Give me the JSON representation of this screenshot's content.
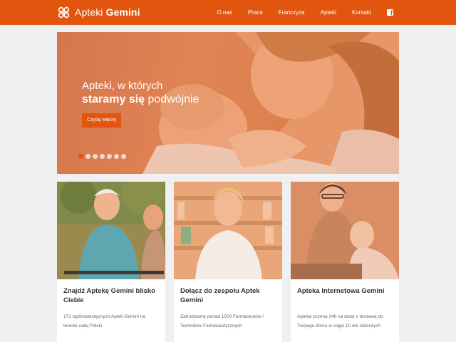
{
  "header": {
    "logo_light": "Apteki",
    "logo_bold": "Gemini",
    "nav": [
      "O nas",
      "Praca",
      "Franczyza",
      "Apteki",
      "Kontakt"
    ],
    "social_icon": "facebook-icon"
  },
  "hero": {
    "line1": "Apteki, w których",
    "line2_strong": "staramy się",
    "line2_rest": " podwójnie",
    "button": "Czytaj więcej",
    "slides_count": 7,
    "active_slide": 1
  },
  "cards": [
    {
      "title": "Znajdź Aptekę Gemini blisko Ciebie",
      "text": "171 ogólnodostępnych Aptek Gemini na terenie całej Polski"
    },
    {
      "title": "Dołącz do zespołu Aptek Gemini",
      "text": "Zatrudniamy ponad 1500 Farmaceutów i Techników Farmaceutycznych"
    },
    {
      "title": "Apteka Internetowa Gemini",
      "text": "Apteka czynna 24h na dobę z dostawą do Twojego domu w ciągu 10 dni roboczych"
    }
  ],
  "colors": {
    "brand": "#e2550f",
    "background": "#f0f0f0",
    "card_bg": "#ffffff"
  }
}
